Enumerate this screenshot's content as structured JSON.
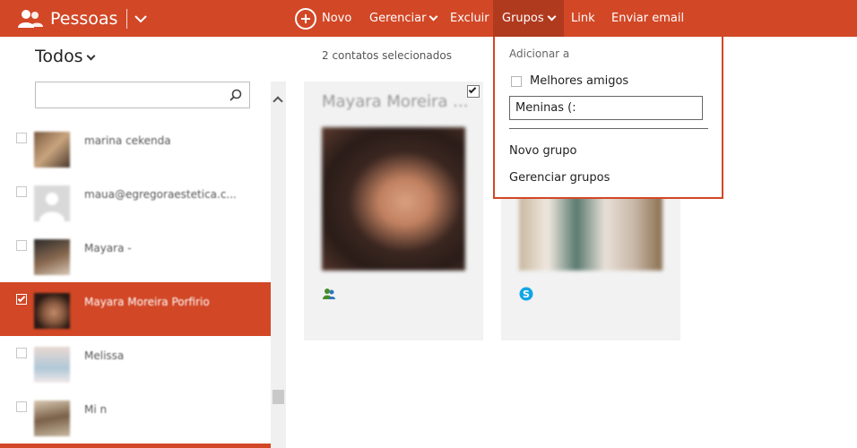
{
  "app": {
    "title": "Pessoas",
    "accent_color": "#d24726"
  },
  "toolbar": {
    "new_label": "Novo",
    "manage_label": "Gerenciar",
    "delete_label": "Excluir",
    "groups_label": "Grupos",
    "link_label": "Link",
    "email_label": "Enviar email"
  },
  "sidebar": {
    "filter_label": "Todos",
    "search": {
      "placeholder": ""
    },
    "contacts": [
      {
        "name": "marina cekenda",
        "checked": false
      },
      {
        "name": "maua@egregoraestetica.c...",
        "checked": false
      },
      {
        "name": "Mayara -",
        "checked": false
      },
      {
        "name": "Mayara Moreira Porfirio",
        "checked": true
      },
      {
        "name": "Melissa",
        "checked": false
      },
      {
        "name": "Mi n",
        "checked": false
      }
    ]
  },
  "main": {
    "selection_status": "2 contatos selecionados",
    "cards": [
      {
        "name": "Mayara Moreira ...",
        "checked": true,
        "source_icon": "messenger-people-icon"
      },
      {
        "name": "",
        "checked": false,
        "source_icon": "skype-icon"
      }
    ]
  },
  "groups_menu": {
    "header": "Adicionar a",
    "groups": [
      {
        "label": "Melhores amigos",
        "checked": false
      }
    ],
    "new_group_input_value": "Meninas (:",
    "new_group_label": "Novo grupo",
    "manage_groups_label": "Gerenciar grupos"
  },
  "icons": {
    "brand": "people-icon",
    "new": "plus-circle-icon",
    "search": "search-icon"
  }
}
